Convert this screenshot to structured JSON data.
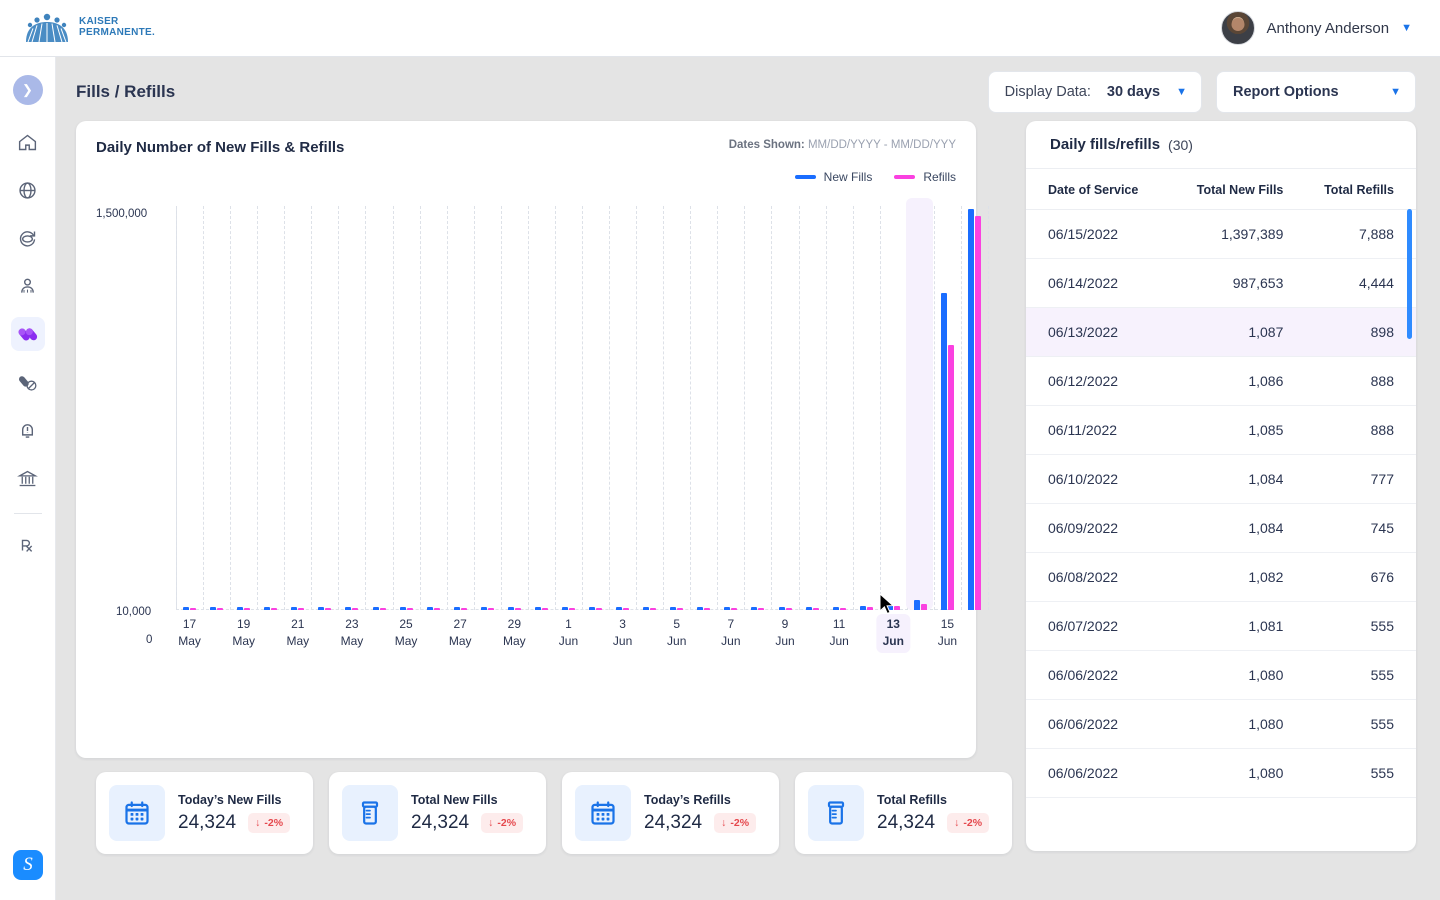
{
  "topbar": {
    "brand_line1": "KAISER",
    "brand_line2": "PERMANENTE.",
    "brand_icon": "kaiser-permanente-logo",
    "user_name": "Anthony Anderson",
    "user_chevron": "chevron-down-icon"
  },
  "rail": {
    "toggle_icon": "chevron-right-icon",
    "items": [
      {
        "icon": "home-icon",
        "name": "home",
        "active": false
      },
      {
        "icon": "globe-icon",
        "name": "globe",
        "active": false
      },
      {
        "icon": "refresh-360-icon",
        "name": "refresh",
        "active": false
      },
      {
        "icon": "people-icon",
        "name": "members",
        "active": false
      },
      {
        "icon": "pills-icon",
        "name": "fills-refills",
        "active": true
      },
      {
        "icon": "pill-block-icon",
        "name": "restrictions",
        "active": false
      },
      {
        "icon": "bell-alert-icon",
        "name": "alerts",
        "active": false
      },
      {
        "icon": "bank-icon",
        "name": "institutions",
        "active": false
      },
      {
        "icon": "rx-icon",
        "name": "prescriptions",
        "active": false
      }
    ],
    "bottom_logo": "S"
  },
  "page": {
    "title": "Fills / Refills",
    "display_data_label": "Display Data:",
    "display_data_value": "30 days",
    "report_options_label": "Report Options"
  },
  "chart_card": {
    "title": "Daily Number of New Fills & Refills",
    "dates_label": "Dates Shown:",
    "dates_value": "MM/DD/YYYY - MM/DD/YYY"
  },
  "chart_data": {
    "type": "bar",
    "title": "Daily Number of New Fills & Refills",
    "xlabel": "",
    "ylabel": "",
    "grid": true,
    "legend_position": "top-right",
    "ytick_labels": [
      "1,500,000",
      "10,000",
      "0"
    ],
    "ylim": [
      0,
      1500000
    ],
    "yscale": "broken",
    "x_tick_labels": [
      {
        "day": "17",
        "month": "May"
      },
      {
        "day": "19",
        "month": "May"
      },
      {
        "day": "21",
        "month": "May"
      },
      {
        "day": "23",
        "month": "May"
      },
      {
        "day": "25",
        "month": "May"
      },
      {
        "day": "27",
        "month": "May"
      },
      {
        "day": "29",
        "month": "May"
      },
      {
        "day": "1",
        "month": "Jun"
      },
      {
        "day": "3",
        "month": "Jun"
      },
      {
        "day": "5",
        "month": "Jun"
      },
      {
        "day": "7",
        "month": "Jun"
      },
      {
        "day": "9",
        "month": "Jun"
      },
      {
        "day": "11",
        "month": "Jun"
      },
      {
        "day": "13",
        "month": "Jun"
      },
      {
        "day": "15",
        "month": "Jun"
      }
    ],
    "highlighted_category": "13 Jun",
    "categories": [
      "17 May",
      "18 May",
      "19 May",
      "20 May",
      "21 May",
      "22 May",
      "23 May",
      "24 May",
      "25 May",
      "26 May",
      "27 May",
      "28 May",
      "29 May",
      "30 May",
      "31 May",
      "1 Jun",
      "2 Jun",
      "3 Jun",
      "4 Jun",
      "5 Jun",
      "6 Jun",
      "7 Jun",
      "8 Jun",
      "9 Jun",
      "10 Jun",
      "11 Jun",
      "12 Jun",
      "13 Jun",
      "14 Jun",
      "15 Jun"
    ],
    "series": [
      {
        "name": "New Fills",
        "color": "#1a6dff",
        "values": [
          1078,
          1079,
          1080,
          1080,
          1081,
          1082,
          1084,
          1083,
          1082,
          1081,
          1080,
          1079,
          1078,
          1077,
          1078,
          1079,
          1080,
          1081,
          1082,
          1083,
          1084,
          1085,
          1086,
          1088,
          1090,
          1200,
          1600,
          3300,
          460000,
          1397389
        ]
      },
      {
        "name": "Refills",
        "color": "#fa41e0",
        "values": [
          430,
          440,
          450,
          455,
          460,
          470,
          520,
          500,
          470,
          450,
          430,
          420,
          410,
          420,
          430,
          440,
          450,
          455,
          460,
          470,
          480,
          500,
          540,
          600,
          700,
          900,
          1300,
          2100,
          230000,
          1280000
        ]
      }
    ]
  },
  "table": {
    "title": "Daily fills/refills",
    "count": "(30)",
    "columns": [
      "Date of Service",
      "Total New Fills",
      "Total Refills"
    ],
    "rows": [
      {
        "date": "06/15/2022",
        "new_fills": "1,397,389",
        "refills": "7,888",
        "selected": false
      },
      {
        "date": "06/14/2022",
        "new_fills": "987,653",
        "refills": "4,444",
        "selected": false
      },
      {
        "date": "06/13/2022",
        "new_fills": "1,087",
        "refills": "898",
        "selected": true
      },
      {
        "date": "06/12/2022",
        "new_fills": "1,086",
        "refills": "888",
        "selected": false
      },
      {
        "date": "06/11/2022",
        "new_fills": "1,085",
        "refills": "888",
        "selected": false
      },
      {
        "date": "06/10/2022",
        "new_fills": "1,084",
        "refills": "777",
        "selected": false
      },
      {
        "date": "06/09/2022",
        "new_fills": "1,084",
        "refills": "745",
        "selected": false
      },
      {
        "date": "06/08/2022",
        "new_fills": "1,082",
        "refills": "676",
        "selected": false
      },
      {
        "date": "06/07/2022",
        "new_fills": "1,081",
        "refills": "555",
        "selected": false
      },
      {
        "date": "06/06/2022",
        "new_fills": "1,080",
        "refills": "555",
        "selected": false
      },
      {
        "date": "06/06/2022",
        "new_fills": "1,080",
        "refills": "555",
        "selected": false
      },
      {
        "date": "06/06/2022",
        "new_fills": "1,080",
        "refills": "555",
        "selected": false
      }
    ]
  },
  "kpis": [
    {
      "icon": "calendar-icon",
      "label": "Today’s New Fills",
      "value": "24,324",
      "delta": "-2%",
      "delta_icon": "arrow-down-icon"
    },
    {
      "icon": "pill-bottle-icon",
      "label": "Total New Fills",
      "value": "24,324",
      "delta": "-2%",
      "delta_icon": "arrow-down-icon"
    },
    {
      "icon": "calendar-icon",
      "label": "Today’s Refills",
      "value": "24,324",
      "delta": "-2%",
      "delta_icon": "arrow-down-icon"
    },
    {
      "icon": "pill-bottle-icon",
      "label": "Total Refills",
      "value": "24,324",
      "delta": "-2%",
      "delta_icon": "arrow-down-icon"
    }
  ],
  "colors": {
    "new_fills": "#1a6dff",
    "refills": "#fa41e0",
    "accent": "#1a73e8",
    "selected_row": "#f7f2fd",
    "delta_negative": "#e5484d"
  }
}
